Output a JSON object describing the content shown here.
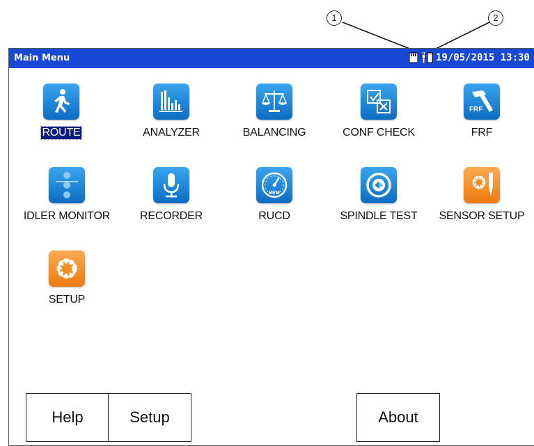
{
  "callouts": [
    "1",
    "2"
  ],
  "titlebar": {
    "title": "Main Menu",
    "datetime": "19/05/2015 13:30",
    "status_icons": [
      "sd-card-icon",
      "battery-plug-icon"
    ]
  },
  "menu_items": [
    {
      "label": "ROUTE",
      "icon": "walking-person-icon",
      "color": "blue",
      "selected": true
    },
    {
      "label": "ANALYZER",
      "icon": "spectrum-bars-icon",
      "color": "blue"
    },
    {
      "label": "BALANCING",
      "icon": "balance-scale-icon",
      "color": "blue"
    },
    {
      "label": "CONF CHECK",
      "icon": "conf-check-icon",
      "color": "blue"
    },
    {
      "label": "FRF",
      "icon": "frf-hammer-icon",
      "color": "blue"
    },
    {
      "label": "IDLER MONITOR",
      "icon": "idler-monitor-icon",
      "color": "blue"
    },
    {
      "label": "RECORDER",
      "icon": "microphone-icon",
      "color": "blue"
    },
    {
      "label": "RUCD",
      "icon": "rpm-gauge-icon",
      "color": "blue"
    },
    {
      "label": "SPINDLE TEST",
      "icon": "spindle-icon",
      "color": "blue"
    },
    {
      "label": "SENSOR SETUP",
      "icon": "sensor-setup-icon",
      "color": "orange"
    },
    {
      "label": "SETUP",
      "icon": "gear-icon",
      "color": "orange"
    }
  ],
  "buttons": {
    "help": "Help",
    "setup": "Setup",
    "about": "About"
  },
  "colors": {
    "titlebar": "#1947d6",
    "tile_blue": "#1f86d8",
    "tile_orange": "#f28a1f",
    "selected": "#0a1a80"
  }
}
